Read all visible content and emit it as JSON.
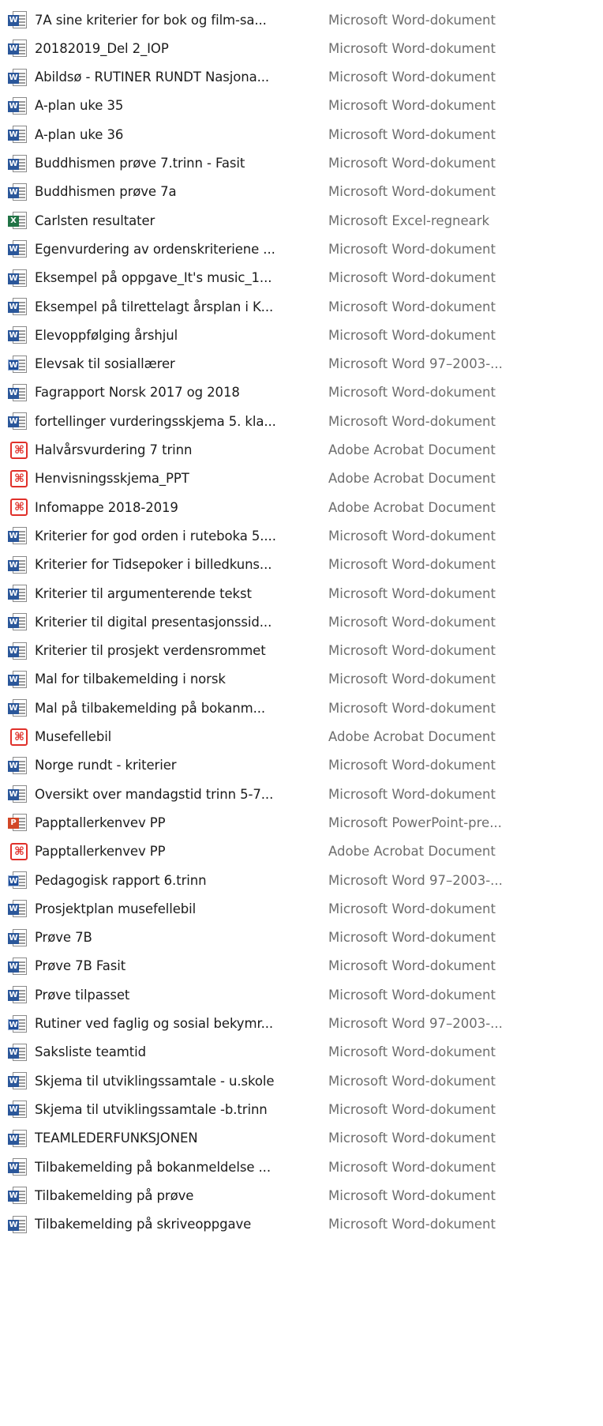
{
  "icons": {
    "word": "word-doc-icon",
    "word97": "word-97-doc-icon",
    "excel": "excel-sheet-icon",
    "pdf": "acrobat-pdf-icon",
    "ppt": "powerpoint-icon"
  },
  "files": [
    {
      "name": "7A sine kriterier for bok og film-sa...",
      "type": "Microsoft Word-dokument",
      "icon": "word"
    },
    {
      "name": "20182019_Del 2_IOP",
      "type": "Microsoft Word-dokument",
      "icon": "word"
    },
    {
      "name": "Abildsø - RUTINER RUNDT Nasjona...",
      "type": "Microsoft Word-dokument",
      "icon": "word"
    },
    {
      "name": "A-plan uke 35",
      "type": "Microsoft Word-dokument",
      "icon": "word"
    },
    {
      "name": "A-plan uke 36",
      "type": "Microsoft Word-dokument",
      "icon": "word"
    },
    {
      "name": "Buddhismen prøve 7.trinn - Fasit",
      "type": "Microsoft Word-dokument",
      "icon": "word"
    },
    {
      "name": "Buddhismen prøve 7a",
      "type": "Microsoft Word-dokument",
      "icon": "word"
    },
    {
      "name": "Carlsten resultater",
      "type": "Microsoft Excel-regneark",
      "icon": "excel"
    },
    {
      "name": "Egenvurdering av ordenskriteriene ...",
      "type": "Microsoft Word-dokument",
      "icon": "word"
    },
    {
      "name": "Eksempel på oppgave_It's music_1...",
      "type": "Microsoft Word-dokument",
      "icon": "word"
    },
    {
      "name": "Eksempel på tilrettelagt årsplan i K...",
      "type": "Microsoft Word-dokument",
      "icon": "word"
    },
    {
      "name": "Elevoppfølging årshjul",
      "type": "Microsoft Word-dokument",
      "icon": "word"
    },
    {
      "name": "Elevsak til sosiallærer",
      "type": "Microsoft Word 97–2003-...",
      "icon": "word97"
    },
    {
      "name": "Fagrapport Norsk 2017 og 2018",
      "type": "Microsoft Word-dokument",
      "icon": "word"
    },
    {
      "name": "fortellinger vurderingsskjema 5. kla...",
      "type": "Microsoft Word-dokument",
      "icon": "word"
    },
    {
      "name": "Halvårsvurdering 7 trinn",
      "type": "Adobe Acrobat Document",
      "icon": "pdf"
    },
    {
      "name": "Henvisningsskjema_PPT",
      "type": "Adobe Acrobat Document",
      "icon": "pdf"
    },
    {
      "name": "Infomappe 2018-2019",
      "type": "Adobe Acrobat Document",
      "icon": "pdf"
    },
    {
      "name": "Kriterier for god orden i ruteboka 5....",
      "type": "Microsoft Word-dokument",
      "icon": "word"
    },
    {
      "name": "Kriterier for Tidsepoker i billedkuns...",
      "type": "Microsoft Word-dokument",
      "icon": "word"
    },
    {
      "name": "Kriterier til argumenterende tekst",
      "type": "Microsoft Word-dokument",
      "icon": "word"
    },
    {
      "name": "Kriterier til digital presentasjonssid...",
      "type": "Microsoft Word-dokument",
      "icon": "word"
    },
    {
      "name": "Kriterier til prosjekt verdensrommet",
      "type": "Microsoft Word-dokument",
      "icon": "word"
    },
    {
      "name": "Mal for tilbakemelding i norsk",
      "type": "Microsoft Word-dokument",
      "icon": "word"
    },
    {
      "name": "Mal på tilbakemelding på bokanm...",
      "type": "Microsoft Word-dokument",
      "icon": "word"
    },
    {
      "name": "Musefellebil",
      "type": "Adobe Acrobat Document",
      "icon": "pdf"
    },
    {
      "name": "Norge rundt - kriterier",
      "type": "Microsoft Word-dokument",
      "icon": "word"
    },
    {
      "name": "Oversikt over mandagstid trinn 5-7...",
      "type": "Microsoft Word-dokument",
      "icon": "word"
    },
    {
      "name": "Papptallerkenvev PP",
      "type": "Microsoft PowerPoint-pre...",
      "icon": "ppt"
    },
    {
      "name": "Papptallerkenvev PP",
      "type": "Adobe Acrobat Document",
      "icon": "pdf"
    },
    {
      "name": "Pedagogisk rapport 6.trinn",
      "type": "Microsoft Word 97–2003-...",
      "icon": "word97"
    },
    {
      "name": "Prosjektplan musefellebil",
      "type": "Microsoft Word-dokument",
      "icon": "word"
    },
    {
      "name": "Prøve 7B",
      "type": "Microsoft Word-dokument",
      "icon": "word"
    },
    {
      "name": "Prøve 7B Fasit",
      "type": "Microsoft Word-dokument",
      "icon": "word"
    },
    {
      "name": "Prøve tilpasset",
      "type": "Microsoft Word-dokument",
      "icon": "word"
    },
    {
      "name": "Rutiner ved faglig og sosial bekymr...",
      "type": "Microsoft Word 97–2003-...",
      "icon": "word97"
    },
    {
      "name": "Saksliste teamtid",
      "type": "Microsoft Word-dokument",
      "icon": "word"
    },
    {
      "name": "Skjema til utviklingssamtale - u.skole",
      "type": "Microsoft Word-dokument",
      "icon": "word"
    },
    {
      "name": "Skjema til utviklingssamtale -b.trinn",
      "type": "Microsoft Word-dokument",
      "icon": "word"
    },
    {
      "name": "TEAMLEDERFUNKSJONEN",
      "type": "Microsoft Word-dokument",
      "icon": "word"
    },
    {
      "name": "Tilbakemelding på bokanmeldelse ...",
      "type": "Microsoft Word-dokument",
      "icon": "word"
    },
    {
      "name": "Tilbakemelding på prøve",
      "type": "Microsoft Word-dokument",
      "icon": "word"
    },
    {
      "name": "Tilbakemelding på skriveoppgave",
      "type": "Microsoft Word-dokument",
      "icon": "word"
    }
  ]
}
